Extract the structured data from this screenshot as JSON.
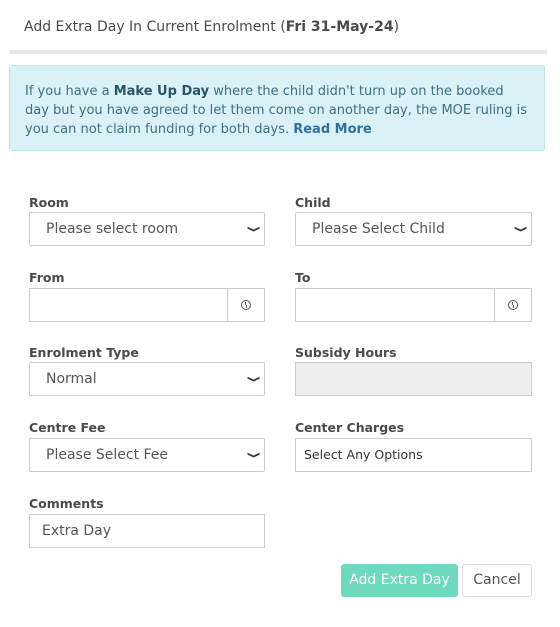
{
  "dialog": {
    "title_prefix": "Add Extra Day In Current Enrolment (",
    "title_date": "Fri 31-May-24",
    "title_suffix": ")"
  },
  "alert": {
    "text_1": "If you have a ",
    "make_up_day": "Make Up Day",
    "text_2": " where the child didn't turn up on the booked day but you have agreed to let them come on another day, the MOE ruling is you can not claim funding for both days. ",
    "read_more": "Read More"
  },
  "form": {
    "room": {
      "label": "Room",
      "value": "Please select room"
    },
    "child": {
      "label": "Child",
      "value": "Please Select Child"
    },
    "from": {
      "label": "From",
      "value": ""
    },
    "to": {
      "label": "To",
      "value": ""
    },
    "enrolment_type": {
      "label": "Enrolment Type",
      "value": "Normal"
    },
    "subsidy_hours": {
      "label": "Subsidy Hours",
      "value": ""
    },
    "centre_fee": {
      "label": "Centre Fee",
      "value": "Please Select Fee"
    },
    "center_charges": {
      "label": "Center Charges",
      "value": "Select Any Options"
    },
    "comments": {
      "label": "Comments",
      "value": "Extra Day"
    }
  },
  "buttons": {
    "add_extra_day": "Add Extra Day",
    "cancel": "Cancel"
  },
  "icons": {
    "dropdown": "chevron-down-icon",
    "time": "clock-icon"
  }
}
